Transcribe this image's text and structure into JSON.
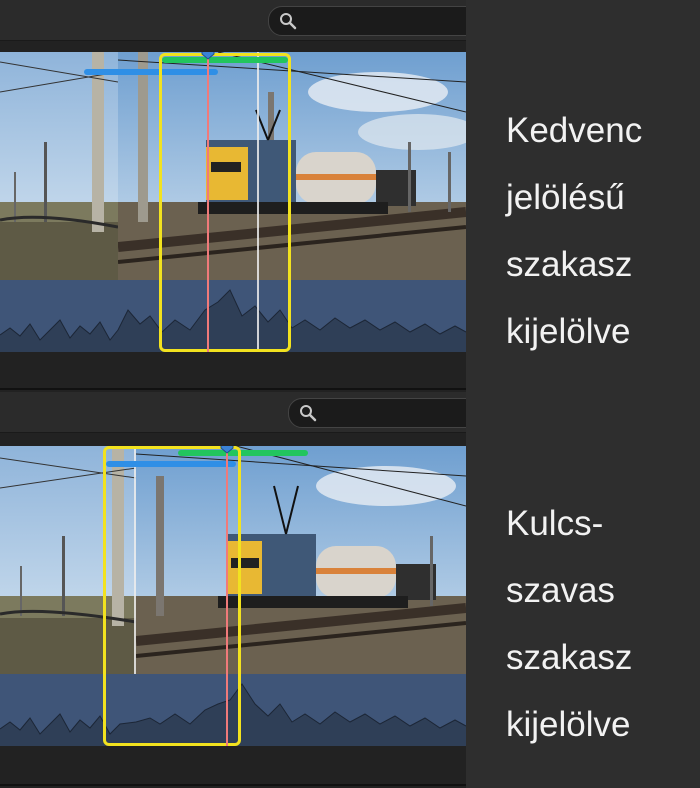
{
  "top_panel": {
    "caption_lines": [
      "Kedvenc",
      "jelölésű",
      "szakasz",
      "kijelölve"
    ],
    "favorite_bar_color": "#22c55e",
    "keyword_bar_color": "#2f8fe6",
    "selection_color": "#f2e21f",
    "icons": {
      "search": "search-icon",
      "playhead": "playhead-icon"
    }
  },
  "bottom_panel": {
    "caption_lines": [
      "Kulcs-",
      "szavas",
      "szakasz",
      "kijelölve"
    ],
    "favorite_bar_color": "#22c55e",
    "keyword_bar_color": "#2f8fe6",
    "selection_color": "#f2e21f",
    "icons": {
      "search": "search-icon",
      "playhead": "playhead-icon"
    }
  }
}
